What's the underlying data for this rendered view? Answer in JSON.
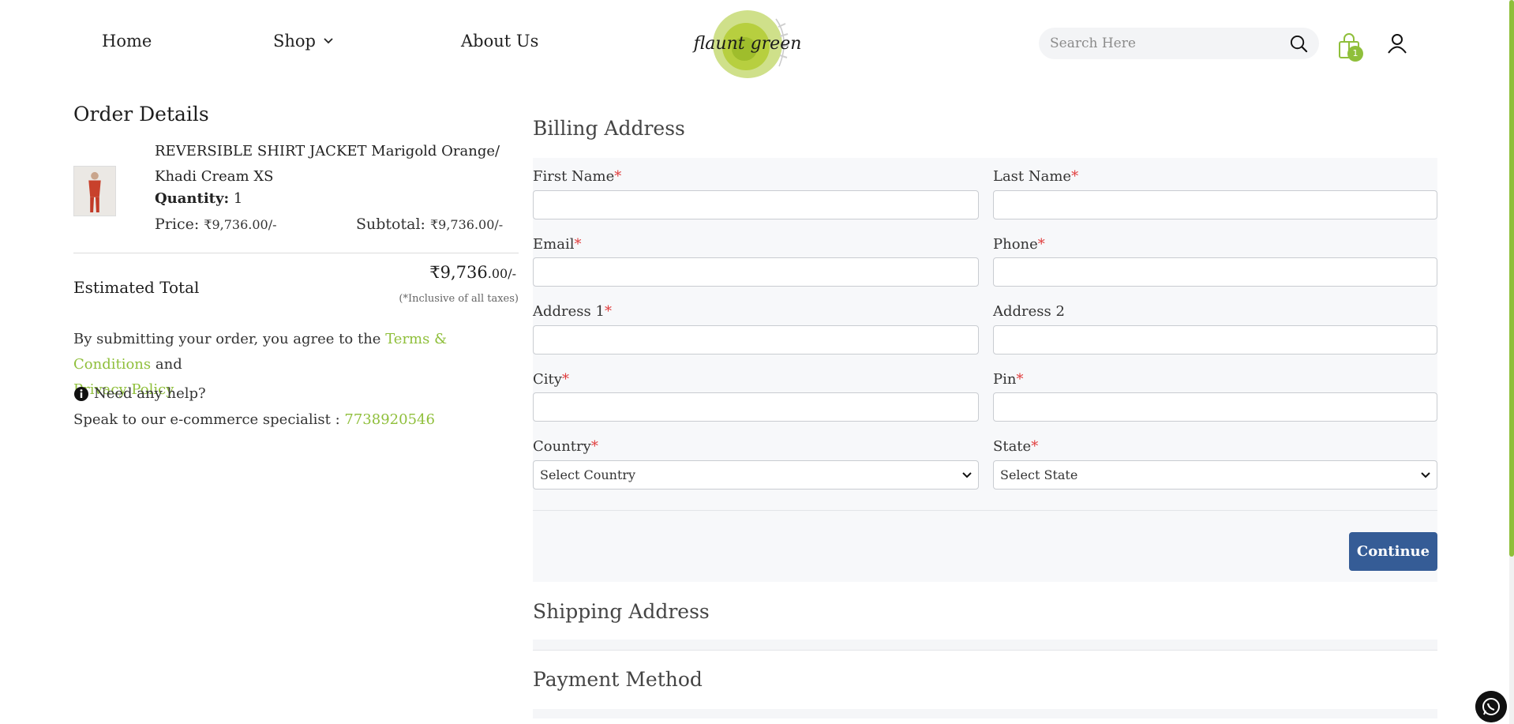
{
  "nav": {
    "home": "Home",
    "shop": "Shop",
    "about": "About Us"
  },
  "logo": {
    "text": "flaunt green"
  },
  "search": {
    "placeholder": "Search Here",
    "value": ""
  },
  "cart": {
    "count": "1"
  },
  "colors": {
    "accent": "#8fbf3b",
    "button": "#355c96",
    "required": "#e03a3a"
  },
  "order": {
    "title": "Order Details",
    "product_name": "REVERSIBLE SHIRT JACKET Marigold Orange/ Khadi Cream XS",
    "quantity_label": "Quantity:",
    "quantity_value": "1",
    "price_label": "Price:",
    "price_value": "₹9,736.00/-",
    "subtotal_label": "Subtotal:",
    "subtotal_value": "₹9,736.00/-",
    "estimated_label": "Estimated Total",
    "estimated_main": "₹9,736",
    "estimated_decimal": ".00/-",
    "tax_note": "(*Inclusive of all taxes)",
    "terms_prefix": "By submitting your order, you agree to the",
    "terms_link": "Terms & Conditions",
    "terms_and": "and",
    "privacy_link": "Privacy Policy",
    "help_text": "Need any help?",
    "specialist_text": "Speak to our e-commerce specialist :",
    "specialist_phone": "7738920546"
  },
  "billing": {
    "title": "Billing Address",
    "first_name": "First Name",
    "last_name": "Last Name",
    "email": "Email",
    "phone": "Phone",
    "address1": "Address 1",
    "address2": "Address 2",
    "city": "City",
    "pin": "Pin",
    "country": "Country",
    "state": "State",
    "country_select": "Select Country",
    "state_select": "Select State",
    "continue": "Continue",
    "required_mark": "*"
  },
  "sections": {
    "shipping": "Shipping Address",
    "payment": "Payment Method"
  }
}
